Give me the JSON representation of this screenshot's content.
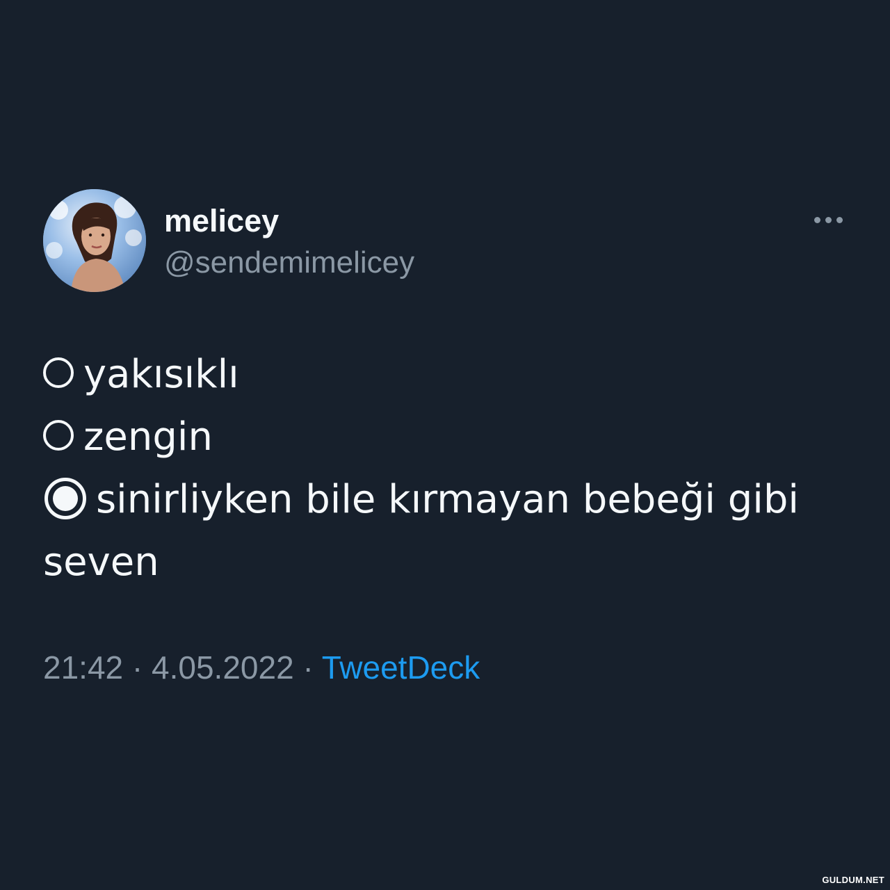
{
  "author": {
    "display_name": "melicey",
    "handle": "@sendemimelicey",
    "avatar_icon": "profile-photo"
  },
  "menu_icon": "more-options-icon",
  "tweet": {
    "lines": [
      "yakısıklı",
      "zengin",
      "sinirliyken bile kırmayan bebeği gibi",
      "seven"
    ],
    "selected_option_index": 2
  },
  "meta": {
    "time": "21:42",
    "separator": "·",
    "date": "4.05.2022",
    "source": "TweetDeck"
  },
  "watermark": "GULDUM.NET",
  "colors": {
    "background": "#17202c",
    "text_primary": "#f5f8fa",
    "text_secondary": "#8b98a5",
    "link": "#1d9bf0"
  }
}
